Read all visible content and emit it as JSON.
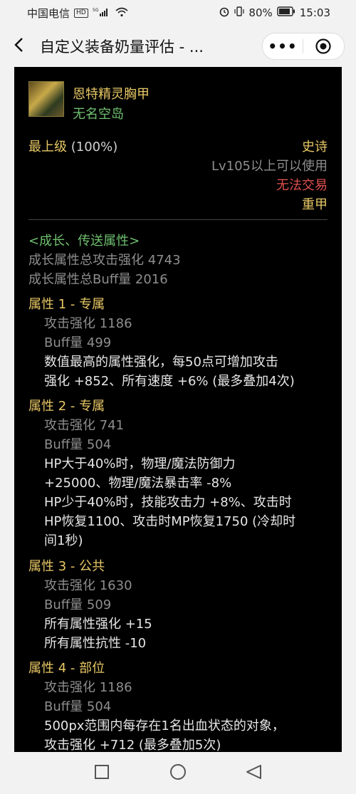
{
  "status_bar": {
    "carrier": "中国电信",
    "hd": "HD",
    "net": "5G",
    "battery": "80%",
    "time": "15:03"
  },
  "header": {
    "title": "自定义装备奶量评估 - ...",
    "more": "•••"
  },
  "item": {
    "name": "恩特精灵胸甲",
    "source": "无名空岛",
    "grade": "最上级",
    "grade_pct": "(100%)",
    "rarity": "史诗",
    "level_req": "Lv105以上可以使用",
    "trade": "无法交易",
    "type": "重甲"
  },
  "growth": {
    "header": "<成长、传送属性>",
    "total_attack": "成长属性总攻击强化 4743",
    "total_buff": "成长属性总Buff量 2016"
  },
  "attributes": [
    {
      "title": "属性 1 - 专属",
      "attack": "攻击强化   1186",
      "buff": "Buff量   499",
      "desc": [
        "数值最高的属性强化，每50点可增加攻击",
        "强化 +852、所有速度 +6% (最多叠加4次)"
      ]
    },
    {
      "title": "属性 2 - 专属",
      "attack": "攻击强化   741",
      "buff": "Buff量   504",
      "desc": [
        "HP大于40%时，物理/魔法防御力",
        "+25000、物理/魔法暴击率 -8%",
        "HP少于40%时，技能攻击力 +8%、攻击时",
        "HP恢复1100、攻击时MP恢复1750 (冷却时",
        "间1秒)"
      ]
    },
    {
      "title": "属性 3 - 公共",
      "attack": "攻击强化   1630",
      "buff": "Buff量   509",
      "desc": [
        "所有属性强化 +15",
        "所有属性抗性 -10"
      ]
    },
    {
      "title": "属性 4 - 部位",
      "attack": "攻击强化   1186",
      "buff": "Buff量   504",
      "desc": [
        "500px范围内每存在1名出血状态的对象，",
        "攻击强化 +712 (最多叠加5次)"
      ]
    }
  ],
  "colors": {
    "gold": "#e8c865",
    "green": "#6fc06f",
    "red": "#e05050",
    "grey": "#8e8e8e"
  }
}
